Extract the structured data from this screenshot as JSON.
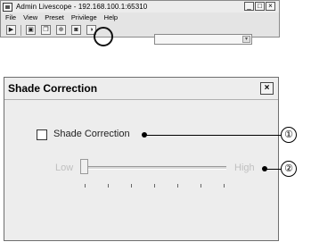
{
  "app": {
    "title": "Admin Livescope - 192.168.100.1:65310",
    "window_buttons": [
      "_",
      "□",
      "×"
    ],
    "menu": [
      "File",
      "View",
      "Preset",
      "Privilege",
      "Help"
    ]
  },
  "toolbar": {
    "buttons": [
      "play-icon",
      "fit-icon",
      "copy-icon",
      "crosshair-icon",
      "camera-icon",
      "shade-correction-icon"
    ],
    "combo_value": "",
    "combo_arrow": "▾"
  },
  "dialog": {
    "title": "Shade Correction",
    "close_label": "×",
    "checkbox_label": "Shade Correction",
    "checkbox_checked": false,
    "slider_low_label": "Low",
    "slider_high_label": "High",
    "slider_value": 0,
    "slider_tick_count": 7
  },
  "callouts": [
    "①",
    "②"
  ]
}
